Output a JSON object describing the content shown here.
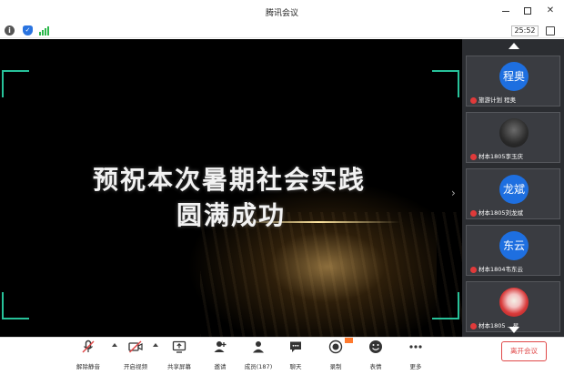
{
  "window": {
    "title": "腾讯会议",
    "timer": "25:52"
  },
  "stage": {
    "line1": "预祝本次暑期社会实践",
    "line2": "圆满成功"
  },
  "participants": [
    {
      "avatar_text": "程奥",
      "name": "旅游计划 程奥"
    },
    {
      "avatar_text": "",
      "name": "材本1805李玉庆"
    },
    {
      "avatar_text": "龙斌",
      "name": "材本1805刘龙斌"
    },
    {
      "avatar_text": "东云",
      "name": "材本1804韦东云"
    },
    {
      "avatar_text": "",
      "name": "材本1805 ...星"
    }
  ],
  "toolbar": {
    "unmute": "解除静音",
    "video": "开启视频",
    "share": "共享屏幕",
    "invite": "邀请",
    "members": "成员(187)",
    "chat": "聊天",
    "record": "录制",
    "reactions": "表情",
    "more": "更多",
    "end": "离开会议"
  },
  "colors": {
    "accent": "#1e6fe0",
    "corner": "#27c29a",
    "danger": "#e04848",
    "sidebar": "#2b2d31"
  }
}
